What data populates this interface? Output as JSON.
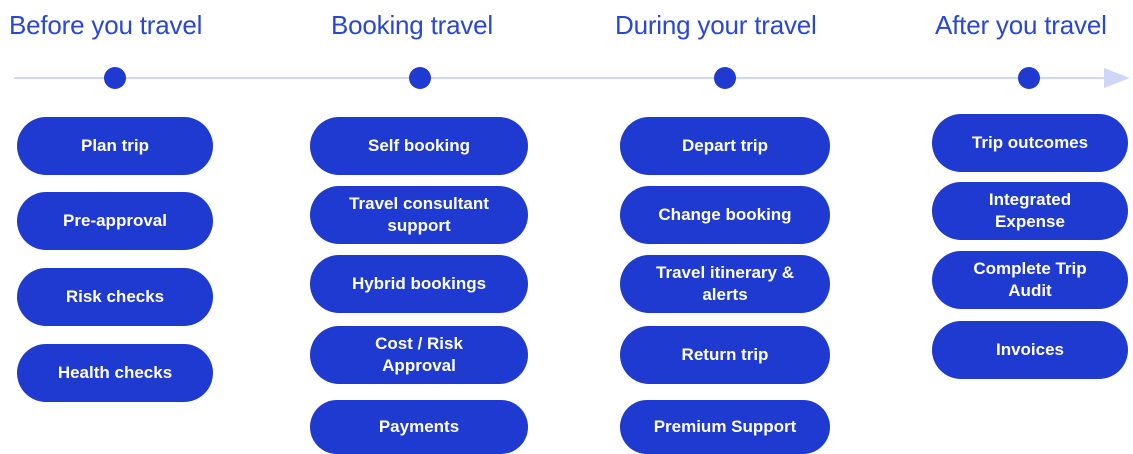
{
  "phases": [
    {
      "title": "Before you travel",
      "items": [
        "Plan trip",
        "Pre-approval",
        "Risk checks",
        "Health checks"
      ]
    },
    {
      "title": "Booking travel",
      "items": [
        "Self booking",
        "Travel consultant support",
        "Hybrid bookings",
        "Cost / Risk Approval",
        "Payments"
      ]
    },
    {
      "title": "During your travel",
      "items": [
        "Depart trip",
        "Change booking",
        "Travel itinerary & alerts",
        "Return trip",
        "Premium Support"
      ]
    },
    {
      "title": "After you travel",
      "items": [
        "Trip outcomes",
        "Integrated Expense",
        "Complete Trip Audit",
        "Invoices"
      ]
    }
  ],
  "colors": {
    "accent": "#1f3ad0",
    "title": "#2a47d4",
    "timeline": "#cfd7f8",
    "pill_text": "#ffffff"
  }
}
